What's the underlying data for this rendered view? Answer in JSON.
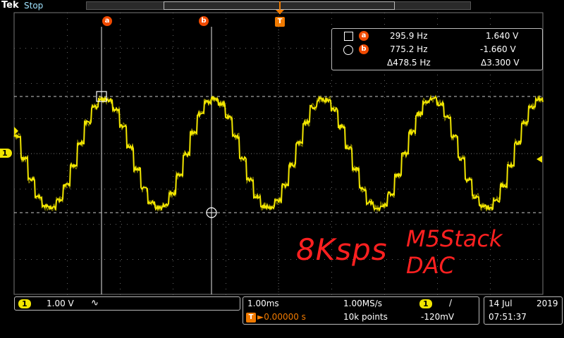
{
  "header": {
    "brand": "Tek",
    "state": "Stop"
  },
  "cursor_markers": {
    "a": "a",
    "b": "b",
    "trigger": "T"
  },
  "readout": {
    "row1": {
      "marker": "a",
      "freq": "295.9 Hz",
      "volt": "1.640 V"
    },
    "row2": {
      "marker": "b",
      "freq": "775.2 Hz",
      "volt": "-1.660 V"
    },
    "row3": {
      "freq": "Δ478.5 Hz",
      "volt": "Δ3.300 V"
    }
  },
  "channel_marker": "1",
  "annotation": {
    "line1": "8Ksps",
    "line2": "M5Stack",
    "line3": "DAC"
  },
  "channel_panel": {
    "badge": "1",
    "scale": "1.00 V",
    "coupling": "∿"
  },
  "timebase_panel": {
    "timescale": "1.00ms",
    "samplerate": "1.00MS/s",
    "trig_badge": "T",
    "position": "►0.00000 s",
    "points": "10k points",
    "trig_channel": "1",
    "slope": "/",
    "trig_level": "-120mV"
  },
  "clock_panel": {
    "date": "14 Jul",
    "year": "2019",
    "time": "07:51:37"
  },
  "colors": {
    "trace": "#f2e600",
    "cursor": "#e6e6e6",
    "annotation": "#ff2020",
    "marker": "#f04a00"
  }
}
